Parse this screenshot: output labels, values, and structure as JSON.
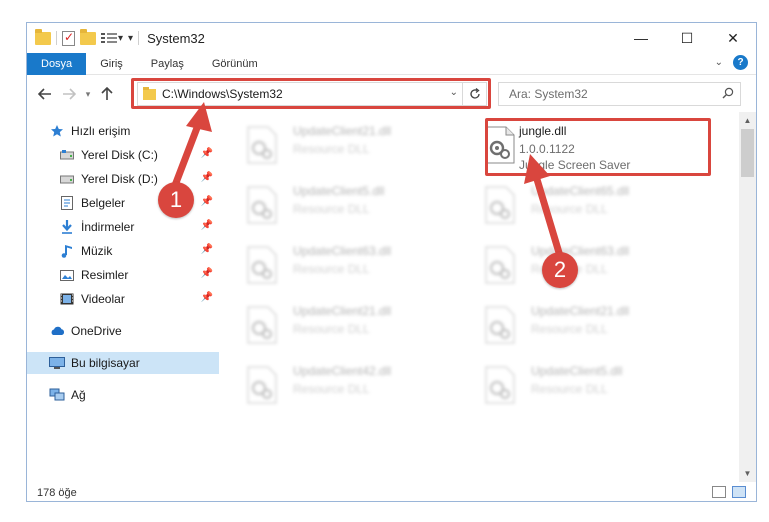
{
  "window": {
    "title": "System32"
  },
  "titlebar_buttons": [
    "—",
    "☐",
    "✕"
  ],
  "ribbon": {
    "tabs": [
      "Dosya",
      "Giriş",
      "Paylaş",
      "Görünüm"
    ],
    "help": "?"
  },
  "address": {
    "path": "C:\\Windows\\System32"
  },
  "search": {
    "placeholder": "Ara: System32"
  },
  "nav": {
    "quick_access": "Hızlı erişim",
    "items": [
      {
        "label": "Yerel Disk (C:)",
        "icon": "drive-icon",
        "pinned": true
      },
      {
        "label": "Yerel Disk (D:)",
        "icon": "drive-icon",
        "pinned": true
      },
      {
        "label": "Belgeler",
        "icon": "documents-icon",
        "pinned": true
      },
      {
        "label": "İndirmeler",
        "icon": "download-icon",
        "pinned": true
      },
      {
        "label": "Müzik",
        "icon": "music-icon",
        "pinned": true
      },
      {
        "label": "Resimler",
        "icon": "pictures-icon",
        "pinned": true
      },
      {
        "label": "Videolar",
        "icon": "videos-icon",
        "pinned": true
      }
    ],
    "onedrive": "OneDrive",
    "this_pc": "Bu bilgisayar",
    "network": "Ağ"
  },
  "files": {
    "left": [
      {
        "name": "UpdateClient21.dll",
        "desc": "Resource DLL"
      },
      {
        "name": "UpdateClient5.dll",
        "desc": "Resource DLL"
      },
      {
        "name": "UpdateClient63.dll",
        "desc": "Resource DLL"
      },
      {
        "name": "UpdateClient21.dll",
        "desc": "Resource DLL"
      },
      {
        "name": "UpdateClient42.dll",
        "desc": "Resource DLL"
      }
    ],
    "right": [
      {
        "name": "jungle.dll",
        "version": "1.0.0.1122",
        "desc": "Jungle Screen Saver"
      },
      {
        "name": "UpdateClient65.dll",
        "desc": "Resource DLL"
      },
      {
        "name": "UpdateClient63.dll",
        "desc": "Resource DLL"
      },
      {
        "name": "UpdateClient21.dll",
        "desc": "Resource DLL"
      },
      {
        "name": "UpdateClient5.dll",
        "desc": "Resource DLL"
      }
    ]
  },
  "status": {
    "count": "178 öğe"
  },
  "callouts": {
    "one": "1",
    "two": "2",
    "color": "#d9463e"
  },
  "colors": {
    "accent": "#1979ca",
    "selection": "#cce4f7"
  }
}
